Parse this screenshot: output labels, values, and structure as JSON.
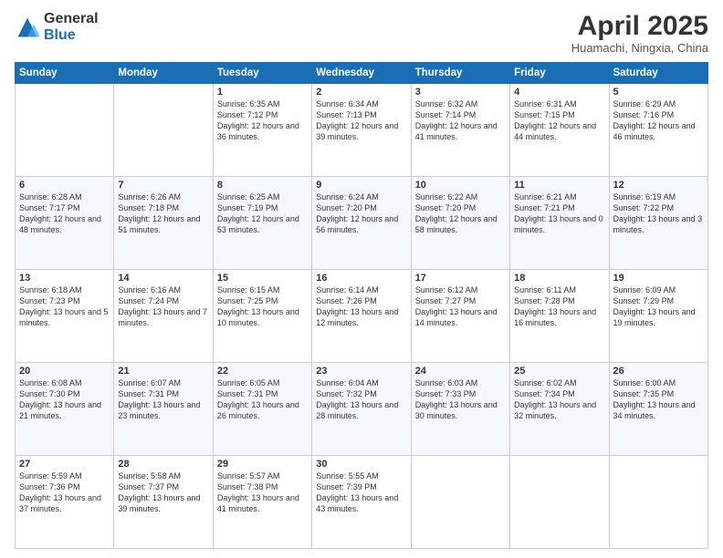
{
  "logo": {
    "general": "General",
    "blue": "Blue"
  },
  "title": "April 2025",
  "subtitle": "Huamachi, Ningxia, China",
  "days_of_week": [
    "Sunday",
    "Monday",
    "Tuesday",
    "Wednesday",
    "Thursday",
    "Friday",
    "Saturday"
  ],
  "weeks": [
    [
      {
        "day": "",
        "info": ""
      },
      {
        "day": "",
        "info": ""
      },
      {
        "day": "1",
        "info": "Sunrise: 6:35 AM\nSunset: 7:12 PM\nDaylight: 12 hours and 36 minutes."
      },
      {
        "day": "2",
        "info": "Sunrise: 6:34 AM\nSunset: 7:13 PM\nDaylight: 12 hours and 39 minutes."
      },
      {
        "day": "3",
        "info": "Sunrise: 6:32 AM\nSunset: 7:14 PM\nDaylight: 12 hours and 41 minutes."
      },
      {
        "day": "4",
        "info": "Sunrise: 6:31 AM\nSunset: 7:15 PM\nDaylight: 12 hours and 44 minutes."
      },
      {
        "day": "5",
        "info": "Sunrise: 6:29 AM\nSunset: 7:16 PM\nDaylight: 12 hours and 46 minutes."
      }
    ],
    [
      {
        "day": "6",
        "info": "Sunrise: 6:28 AM\nSunset: 7:17 PM\nDaylight: 12 hours and 48 minutes."
      },
      {
        "day": "7",
        "info": "Sunrise: 6:26 AM\nSunset: 7:18 PM\nDaylight: 12 hours and 51 minutes."
      },
      {
        "day": "8",
        "info": "Sunrise: 6:25 AM\nSunset: 7:19 PM\nDaylight: 12 hours and 53 minutes."
      },
      {
        "day": "9",
        "info": "Sunrise: 6:24 AM\nSunset: 7:20 PM\nDaylight: 12 hours and 56 minutes."
      },
      {
        "day": "10",
        "info": "Sunrise: 6:22 AM\nSunset: 7:20 PM\nDaylight: 12 hours and 58 minutes."
      },
      {
        "day": "11",
        "info": "Sunrise: 6:21 AM\nSunset: 7:21 PM\nDaylight: 13 hours and 0 minutes."
      },
      {
        "day": "12",
        "info": "Sunrise: 6:19 AM\nSunset: 7:22 PM\nDaylight: 13 hours and 3 minutes."
      }
    ],
    [
      {
        "day": "13",
        "info": "Sunrise: 6:18 AM\nSunset: 7:23 PM\nDaylight: 13 hours and 5 minutes."
      },
      {
        "day": "14",
        "info": "Sunrise: 6:16 AM\nSunset: 7:24 PM\nDaylight: 13 hours and 7 minutes."
      },
      {
        "day": "15",
        "info": "Sunrise: 6:15 AM\nSunset: 7:25 PM\nDaylight: 13 hours and 10 minutes."
      },
      {
        "day": "16",
        "info": "Sunrise: 6:14 AM\nSunset: 7:26 PM\nDaylight: 13 hours and 12 minutes."
      },
      {
        "day": "17",
        "info": "Sunrise: 6:12 AM\nSunset: 7:27 PM\nDaylight: 13 hours and 14 minutes."
      },
      {
        "day": "18",
        "info": "Sunrise: 6:11 AM\nSunset: 7:28 PM\nDaylight: 13 hours and 16 minutes."
      },
      {
        "day": "19",
        "info": "Sunrise: 6:09 AM\nSunset: 7:29 PM\nDaylight: 13 hours and 19 minutes."
      }
    ],
    [
      {
        "day": "20",
        "info": "Sunrise: 6:08 AM\nSunset: 7:30 PM\nDaylight: 13 hours and 21 minutes."
      },
      {
        "day": "21",
        "info": "Sunrise: 6:07 AM\nSunset: 7:31 PM\nDaylight: 13 hours and 23 minutes."
      },
      {
        "day": "22",
        "info": "Sunrise: 6:05 AM\nSunset: 7:31 PM\nDaylight: 13 hours and 26 minutes."
      },
      {
        "day": "23",
        "info": "Sunrise: 6:04 AM\nSunset: 7:32 PM\nDaylight: 13 hours and 28 minutes."
      },
      {
        "day": "24",
        "info": "Sunrise: 6:03 AM\nSunset: 7:33 PM\nDaylight: 13 hours and 30 minutes."
      },
      {
        "day": "25",
        "info": "Sunrise: 6:02 AM\nSunset: 7:34 PM\nDaylight: 13 hours and 32 minutes."
      },
      {
        "day": "26",
        "info": "Sunrise: 6:00 AM\nSunset: 7:35 PM\nDaylight: 13 hours and 34 minutes."
      }
    ],
    [
      {
        "day": "27",
        "info": "Sunrise: 5:59 AM\nSunset: 7:36 PM\nDaylight: 13 hours and 37 minutes."
      },
      {
        "day": "28",
        "info": "Sunrise: 5:58 AM\nSunset: 7:37 PM\nDaylight: 13 hours and 39 minutes."
      },
      {
        "day": "29",
        "info": "Sunrise: 5:57 AM\nSunset: 7:38 PM\nDaylight: 13 hours and 41 minutes."
      },
      {
        "day": "30",
        "info": "Sunrise: 5:55 AM\nSunset: 7:39 PM\nDaylight: 13 hours and 43 minutes."
      },
      {
        "day": "",
        "info": ""
      },
      {
        "day": "",
        "info": ""
      },
      {
        "day": "",
        "info": ""
      }
    ]
  ]
}
